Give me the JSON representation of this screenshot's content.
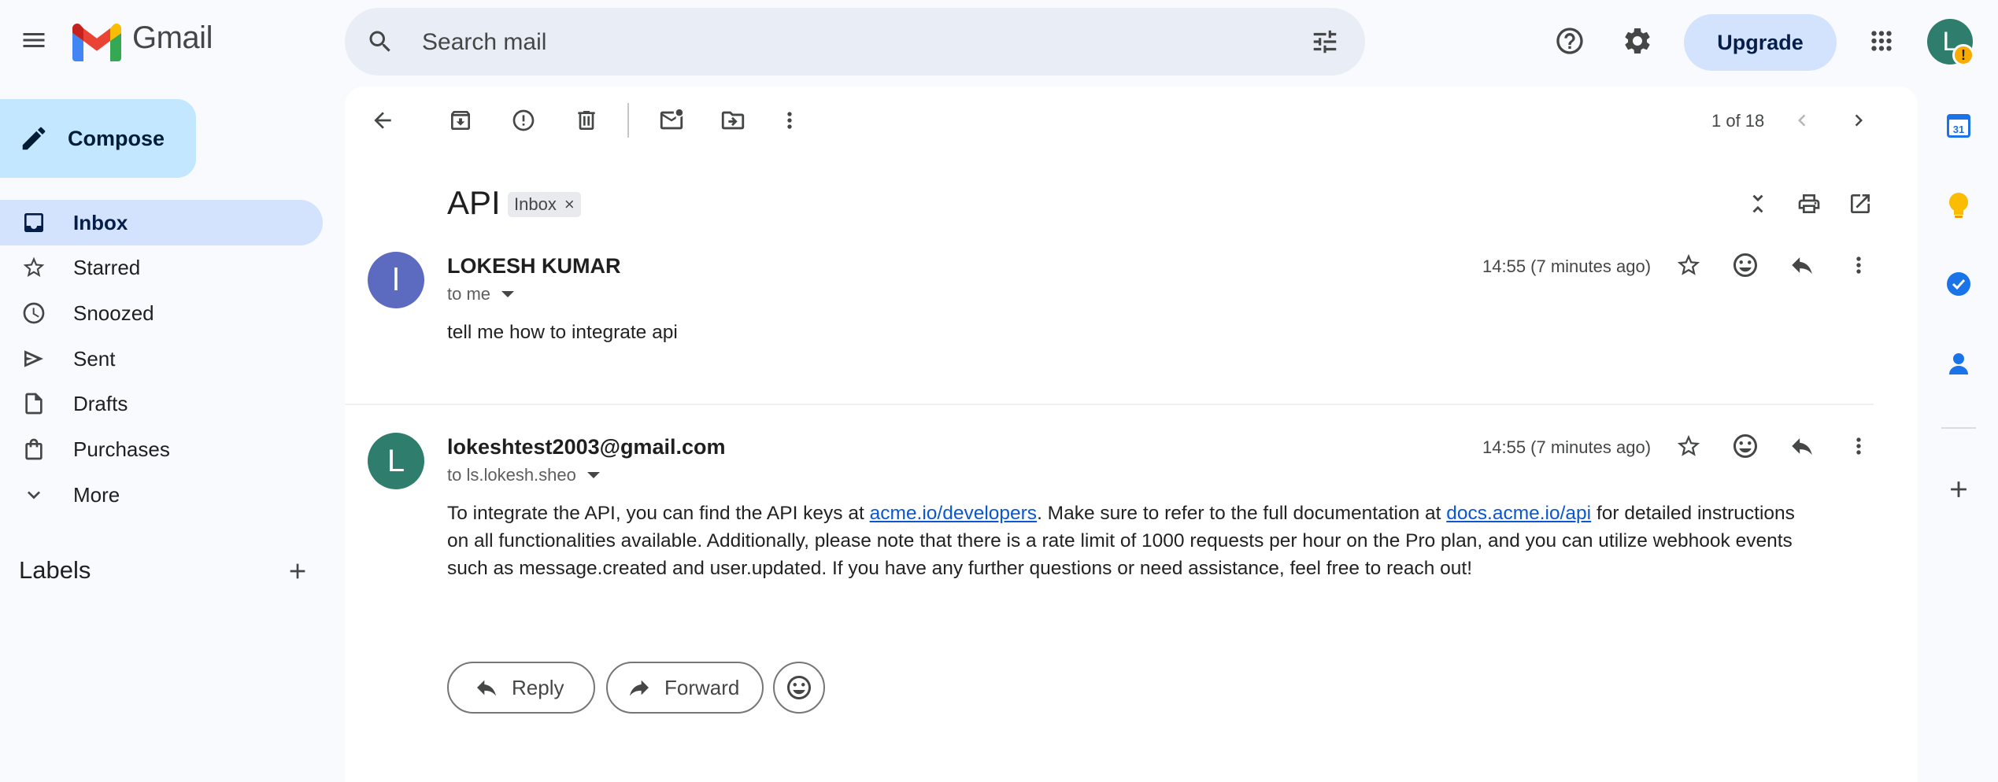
{
  "app": {
    "name": "Gmail"
  },
  "search": {
    "placeholder": "Search mail"
  },
  "header": {
    "upgrade_label": "Upgrade",
    "account_initial": "L",
    "account_alert": "!"
  },
  "compose": {
    "label": "Compose"
  },
  "nav": [
    {
      "id": "inbox",
      "label": "Inbox",
      "icon": "inbox-icon",
      "active": true
    },
    {
      "id": "starred",
      "label": "Starred",
      "icon": "star-icon"
    },
    {
      "id": "snoozed",
      "label": "Snoozed",
      "icon": "clock-icon"
    },
    {
      "id": "sent",
      "label": "Sent",
      "icon": "send-icon"
    },
    {
      "id": "drafts",
      "label": "Drafts",
      "icon": "draft-icon"
    },
    {
      "id": "purchases",
      "label": "Purchases",
      "icon": "shopping-bag-icon"
    },
    {
      "id": "more",
      "label": "More",
      "icon": "chevron-down-icon"
    }
  ],
  "labels": {
    "title": "Labels"
  },
  "toolbar": {
    "pager": "1 of 18"
  },
  "thread": {
    "subject": "API",
    "label_chip": "Inbox",
    "label_chip_close": "×",
    "messages": [
      {
        "avatar_initial": "l",
        "avatar_color": "#5c6bc0",
        "sender": "LOKESH KUMAR",
        "recipient": "to me",
        "time": "14:55 (7 minutes ago)",
        "body": "tell me how to integrate api"
      },
      {
        "avatar_initial": "L",
        "avatar_color": "#2f7d6c",
        "sender": "lokeshtest2003@gmail.com",
        "recipient": "to ls.lokesh.sheo",
        "time": "14:55 (7 minutes ago)",
        "body_parts": {
          "p1": "To integrate the API, you can find the API keys at ",
          "link1": "acme.io/developers",
          "p2": ". Make sure to refer to the full documentation at ",
          "link2": "docs.acme.io/api",
          "p3": " for detailed instructions on all functionalities available. Additionally, please note that there is a rate limit of 1000 requests per hour on the Pro plan, and you can utilize webhook events such as message.created and user.updated. If you have any further questions or need assistance, feel free to reach out!"
        }
      }
    ]
  },
  "actions": {
    "reply_label": "Reply",
    "forward_label": "Forward"
  },
  "side_panel": {
    "calendar_day": "31"
  },
  "colors": {
    "accent": "#0b57d0",
    "compose_bg": "#c2e7ff",
    "active_nav": "#d3e3fd"
  }
}
